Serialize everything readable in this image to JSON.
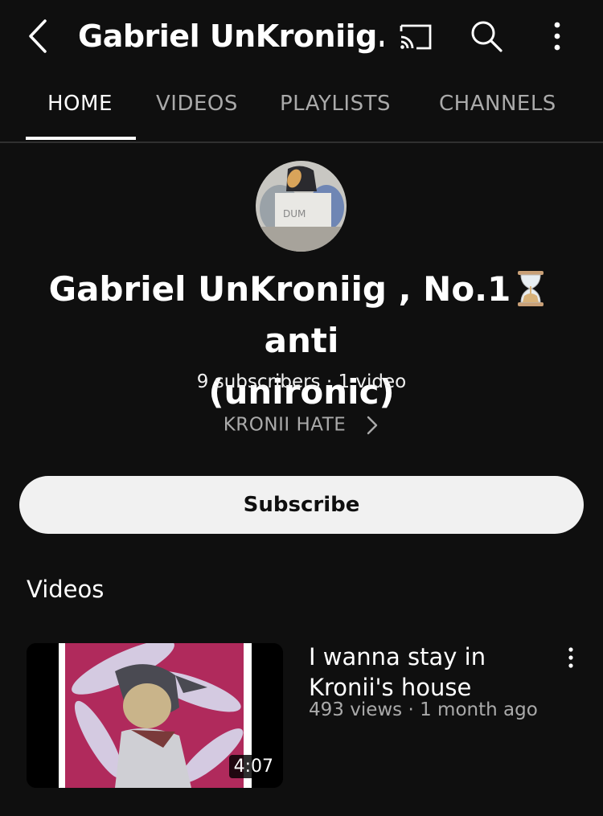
{
  "header": {
    "title": "Gabriel UnKroniig..."
  },
  "tabs": [
    {
      "label": "HOME",
      "active": true
    },
    {
      "label": "VIDEOS",
      "active": false
    },
    {
      "label": "PLAYLISTS",
      "active": false
    },
    {
      "label": "CHANNELS",
      "active": false
    }
  ],
  "channel": {
    "name_part1": "Gabriel UnKroniig , No.1",
    "name_part2": "anti",
    "name_part3": "(unironic)",
    "meta": "9 subscribers · 1 video",
    "link_label": "KRONII HATE",
    "avatar_text": "DUM"
  },
  "subscribe": {
    "label": "Subscribe"
  },
  "section": {
    "title": "Videos"
  },
  "videos": [
    {
      "title": "I wanna stay in Kronii's house",
      "meta": "493 views · 1 month ago",
      "duration": "4:07"
    }
  ],
  "icons": {
    "back": "chevron-left-icon",
    "cast": "cast-icon",
    "search": "search-icon",
    "more": "more-vertical-icon",
    "hourglass": "hourglass-emoji",
    "link": "chevron-right-icon"
  },
  "colors": {
    "background": "#0f0f0f",
    "text_primary": "#ffffff",
    "text_secondary": "#aaaaaa",
    "subscribe_bg": "#f1f1f1",
    "thumbnail_accent": "#b02a5c"
  }
}
